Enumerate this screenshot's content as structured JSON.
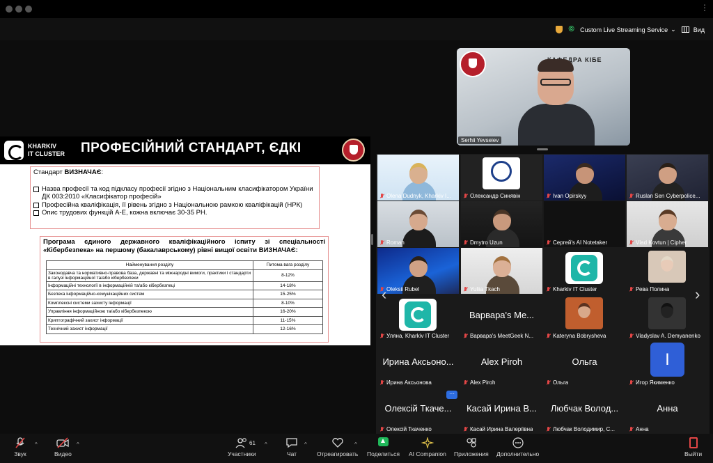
{
  "topbar": {
    "stream_label": "Custom Live Streaming Service",
    "view_label": "Вид"
  },
  "speaker": {
    "name": "Serhii Yevseiev",
    "sign_text": "КАФЕДРА КІБЕ"
  },
  "slide": {
    "logo_line1": "KHARKIV",
    "logo_line2": "IT CLUSTER",
    "title": "ПРОФЕСІЙНИЙ СТАНДАРТ, ЄДКІ",
    "box1_lead_prefix": "Стандарт ",
    "box1_lead_bold": "ВИЗНАЧАЄ",
    "box1_lead_suffix": ":",
    "box1_items": [
      "Назва професії та код підкласу професії згідно з Національним класифікатором України ДК 003:2010 «Класифікатор професій»",
      "Професійна кваліфікація, її рівень згідно з Національною рамкою кваліфікацій (НРК)",
      "Опис трудових функцій A-E, кожна включає  30-35 PH."
    ],
    "box2_title": "Програма єдиного державного кваліфікаційного іспиту зі спеціальності «Кібербезпека» на першому (бакалаврському) рівні вищої освіти ВИЗНАЧАЄ:",
    "table_headers": [
      "Найменування розділу",
      "Питома вага розділу"
    ],
    "table_rows": [
      [
        "Законодавча та нормативно-правова база, державні та міжнародні вимоги, практики і стандарти в галузі інформаційної та/або кібербезпеки",
        "8-12%"
      ],
      [
        "Інформаційні технології в інформаційній та/або кібербезпеці",
        "14-18%"
      ],
      [
        "Безпека інформаційно-комунікаційних систем",
        "15-25%"
      ],
      [
        "Комплексні системи захисту інформації",
        "8-10%"
      ],
      [
        "Управління інформаційною та/або кібербезпекою",
        "16-20%"
      ],
      [
        "Криптографічний захист інформації",
        "11-15%"
      ],
      [
        "Технічний захист інформації",
        "12-16%"
      ]
    ]
  },
  "gallery": {
    "tiles": [
      {
        "name": "Olena Dudnyk, Kharkiv I..."
      },
      {
        "name": "Олександр Синявін"
      },
      {
        "name": "Ivan Opirskyy"
      },
      {
        "name": "Ruslan Sen Cyberpolice..."
      },
      {
        "name": "Roman"
      },
      {
        "name": "Dmytro Uzun"
      },
      {
        "name": "Сергей's AI Notetaker"
      },
      {
        "name": "Vlad Kovtun | Cipher"
      },
      {
        "name": "Oleksii Rubel"
      },
      {
        "name": "Yuliia Tkach"
      },
      {
        "name": "Kharkiv IT Cluster"
      },
      {
        "name": "Рева Полина"
      },
      {
        "name": "Уляна, Kharkiv IT Cluster"
      },
      {
        "name": "Варвара's MeetGeek N...",
        "big": "Варвара's Me..."
      },
      {
        "name": "Kateryna Bobrysheva"
      },
      {
        "name": "Vladyslav A. Demyanenko"
      },
      {
        "name": "Ирина Аксьонова",
        "big": "Ирина Аксьоно..."
      },
      {
        "name": "Alex Piroh",
        "big": "Alex Piroh"
      },
      {
        "name": "Ольга",
        "big": "Ольга"
      },
      {
        "name": "Игор Якименко",
        "avatar": "I"
      },
      {
        "name": "Олексій Ткаченко",
        "big": "Олексій Ткаче..."
      },
      {
        "name": "Касай Ирина Валеріївна",
        "big": "Касай Ирина В..."
      },
      {
        "name": "Любчак Володимир,  С...",
        "big": "Любчак Волод..."
      },
      {
        "name": "Анна",
        "big": "Анна"
      }
    ],
    "more_pill": "···"
  },
  "toolbar": {
    "audio": "Звук",
    "video": "Видео",
    "participants": "Участники",
    "participants_count": "61",
    "chat": "Чат",
    "react": "Отреагировать",
    "share": "Поделиться",
    "ai": "AI Companion",
    "apps": "Приложения",
    "more": "Дополнительно",
    "leave": "Выйти"
  },
  "colors": {
    "accent_green": "#20b85a",
    "muted_red": "#e34646",
    "brand_blue": "#2d6de0",
    "cluster_teal": "#1fb6a8"
  }
}
